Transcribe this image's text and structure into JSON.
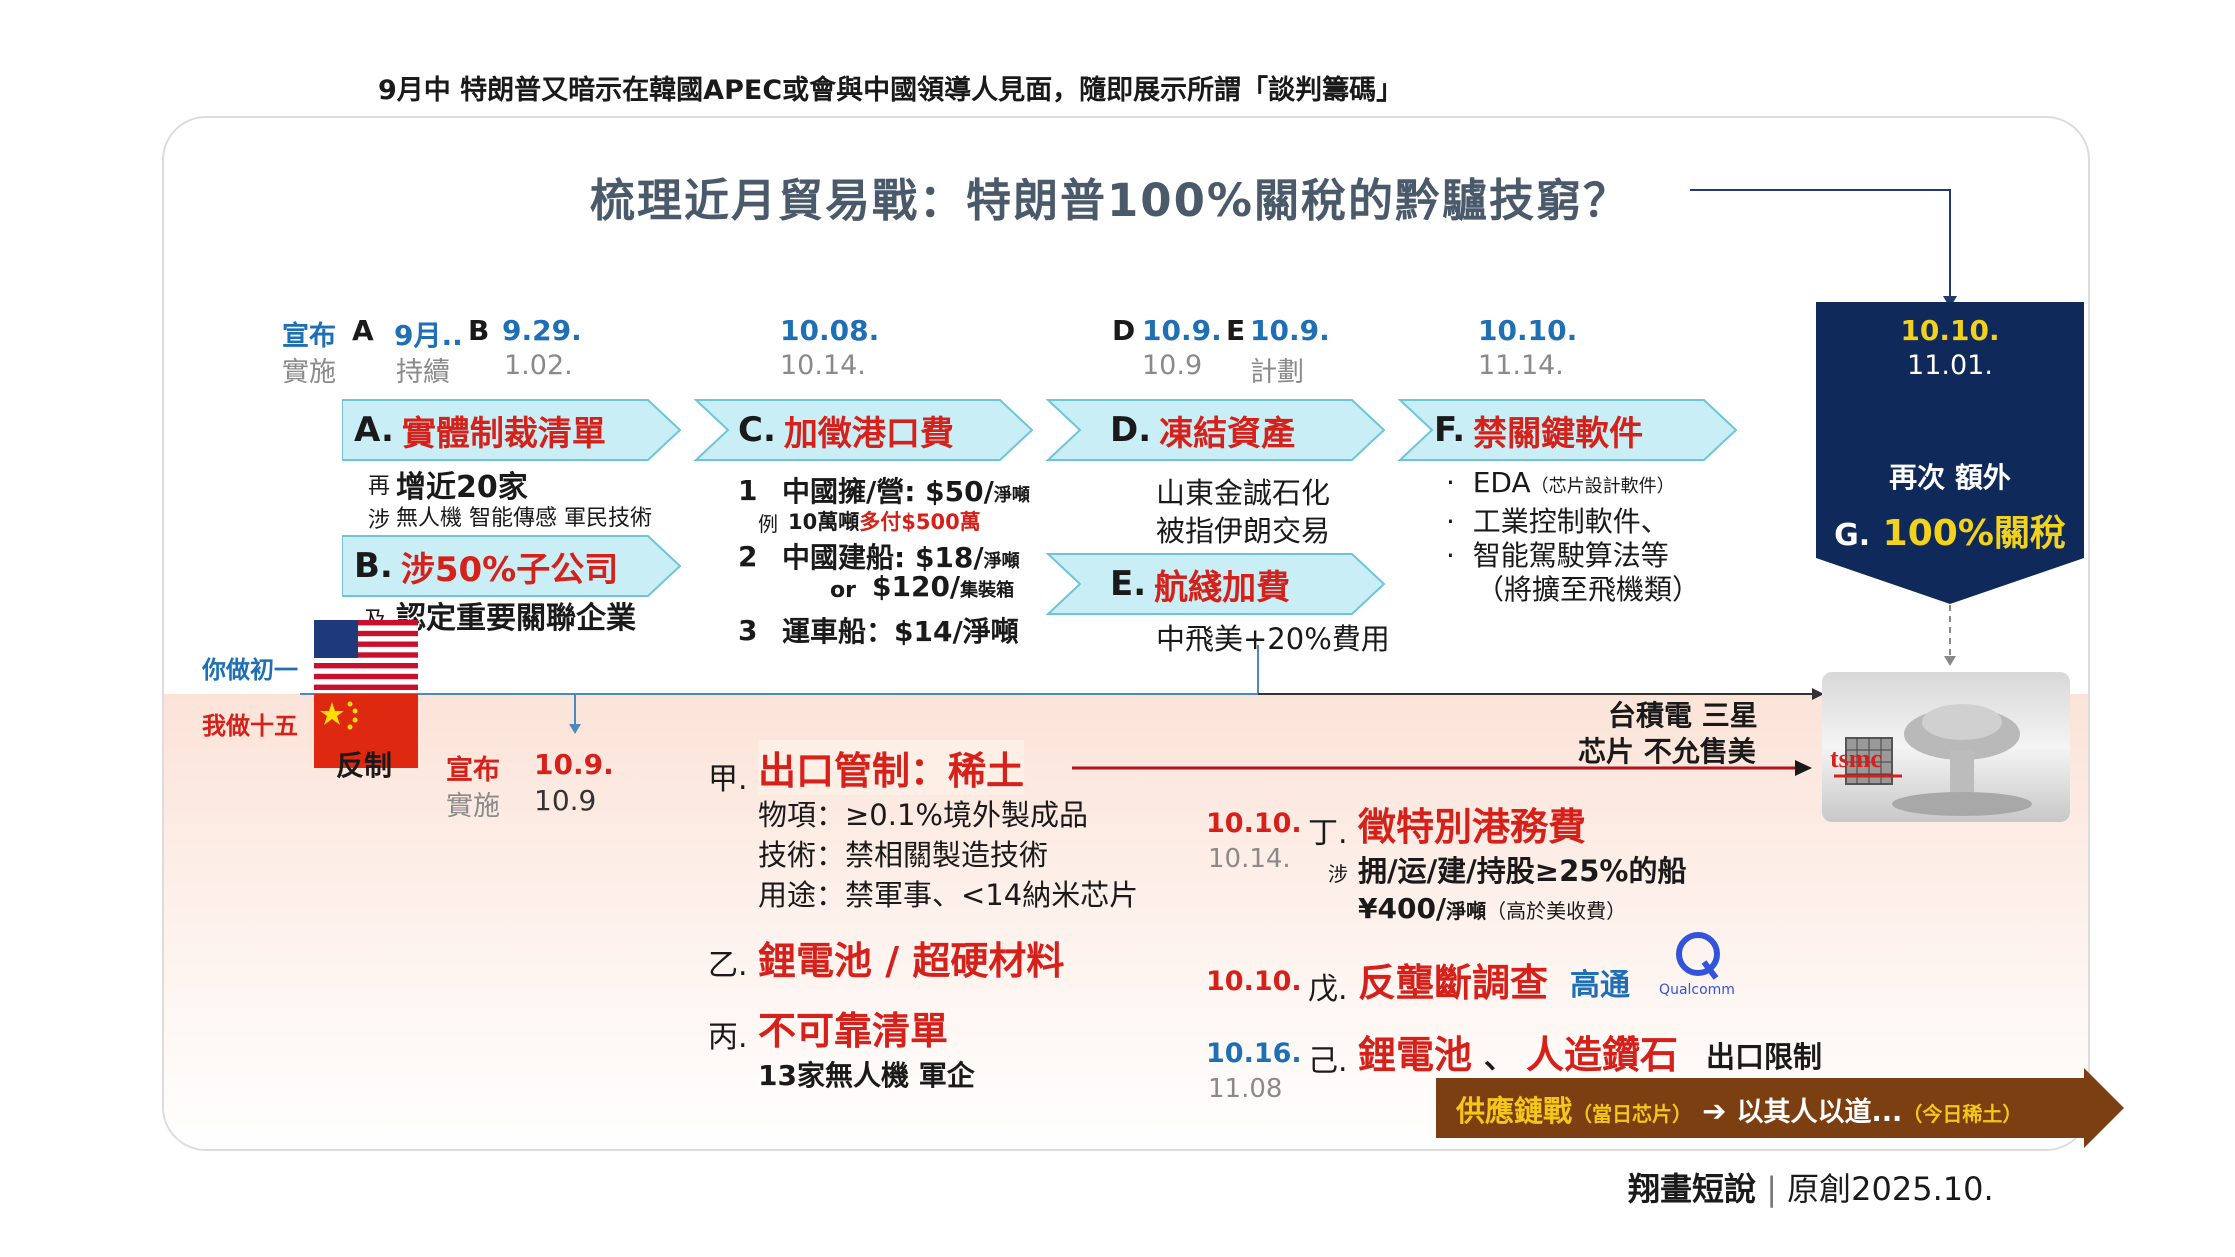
{
  "header": {
    "subtitle": "9月中 特朗普又暗示在韓國APEC或會與中國領導人見面，隨即展示所謂「談判籌碼」"
  },
  "title": "梳理近月貿易戰：特朗普100%關稅的黔驢技窮？",
  "colors": {
    "accent_blue": "#1f6fb5",
    "accent_red": "#d6201a",
    "box_navy": "#0f2a5a",
    "chevron_fill": "#c9eef6",
    "arrow_brown": "#7b3f12"
  },
  "us": {
    "row_labels": {
      "announce": "宣布",
      "implement": "實施"
    },
    "date_cols": [
      {
        "letter_a": "A",
        "announce_a": "9月..",
        "letter_b": "B",
        "announce_b": "9.29.",
        "implement_a": "持續",
        "implement_b": "1.02."
      },
      {
        "announce": "10.08.",
        "implement": "10.14."
      },
      {
        "letter_d": "D",
        "announce_d": "10.9.",
        "letter_e": "E",
        "announce_e": "10.9.",
        "implement_d": "10.9",
        "implement_e": "計劃"
      },
      {
        "announce": "10.10.",
        "implement": "11.14."
      }
    ],
    "actions": {
      "a": {
        "letter": "A.",
        "title": "實體制裁清單",
        "prefix1": "再",
        "line1": "增近20家",
        "prefix2": "涉",
        "line2": "無人機 智能傳感 軍民技術"
      },
      "b": {
        "letter": "B.",
        "title": "涉50%子公司",
        "prefix": "及",
        "line": "認定重要關聯企業"
      },
      "c": {
        "letter": "C.",
        "title": "加徵港口費",
        "i1_num": "1",
        "i1_text": "中國擁/營: $50/",
        "i1_unit": "淨噸",
        "ex_prefix": "例",
        "ex_text": "10萬噸",
        "ex_red": "多付$500萬",
        "i2_num": "2",
        "i2_text": "中國建船: $18/",
        "i2_unit": "淨噸",
        "i2b_or": "or",
        "i2b_text": "$120/",
        "i2b_unit": "集裝箱",
        "i3_num": "3",
        "i3_text": "運車船：$14/淨噸"
      },
      "d": {
        "letter": "D.",
        "title": "凍結資產",
        "line1": "山東金誠石化",
        "line2": "被指伊朗交易"
      },
      "e": {
        "letter": "E.",
        "title": "航綫加費",
        "line": "中飛美+20%費用"
      },
      "f": {
        "letter": "F.",
        "title": "禁關鍵軟件",
        "items": [
          {
            "text": "EDA",
            "note": "（芯片設計軟件）"
          },
          {
            "text": "工業控制軟件、",
            "note": ""
          },
          {
            "text": "智能駕駛算法等",
            "note": ""
          },
          {
            "text": "（將擴至飛機類）",
            "note": ""
          }
        ]
      }
    },
    "g_box": {
      "announce": "10.10.",
      "implement": "11.01.",
      "line1": "再次 額外",
      "letter": "G.",
      "title": "100%關稅"
    }
  },
  "sides": {
    "us_label": "你做初一",
    "cn_label": "我做十五",
    "counter_label": "反制"
  },
  "cn": {
    "row_labels": {
      "announce": "宣布",
      "implement": "實施"
    },
    "announce": "10.9.",
    "implement": "10.9",
    "jia": {
      "prefix": "甲.",
      "title": "出口管制：稀土",
      "lines": [
        "物項：≥0.1%境外製成品",
        "技術：禁相關製造技術",
        "用途：禁軍事、<14納米芯片"
      ]
    },
    "yi": {
      "prefix": "乙.",
      "title": "鋰電池 / 超硬材料"
    },
    "bing": {
      "prefix": "丙.",
      "title": "不可靠清單",
      "line": "13家無人機 軍企"
    },
    "ding": {
      "date": "10.10.",
      "date2": "10.14.",
      "prefix": "丁.",
      "title": "徵特別港務費",
      "sub_prefix": "涉",
      "sub": "拥/运/建/持股≥25%的船",
      "fee": "¥400/",
      "fee_unit": "淨噸",
      "fee_note": "（高於美收費）"
    },
    "wu": {
      "date": "10.10.",
      "prefix": "戊.",
      "title": "反壟斷調查",
      "target": "高通",
      "logo_text": "Qualcomm"
    },
    "ji": {
      "date": "10.16.",
      "date2": "11.08",
      "prefix": "己.",
      "title1": "鋰電池",
      "sep": "、",
      "title2": "人造鑽石",
      "tail": "出口限制"
    }
  },
  "tsmc": {
    "note1": "台積電 三星",
    "note2": "芯片 不允售美",
    "logo": "tsmc"
  },
  "supply_banner": {
    "title": "供應鏈戰",
    "note1": "（當日芯片）",
    "arrow": "➔",
    "text": "以其人以道...",
    "note2": "（今日稀土）"
  },
  "footer": {
    "brand": "翔畫短說",
    "sep": "|",
    "original": "原創2025.10."
  },
  "icons": [
    "us-flag-icon",
    "china-flag-icon",
    "qualcomm-logo-icon",
    "tsmc-logo-icon",
    "mushroom-cloud-icon"
  ]
}
